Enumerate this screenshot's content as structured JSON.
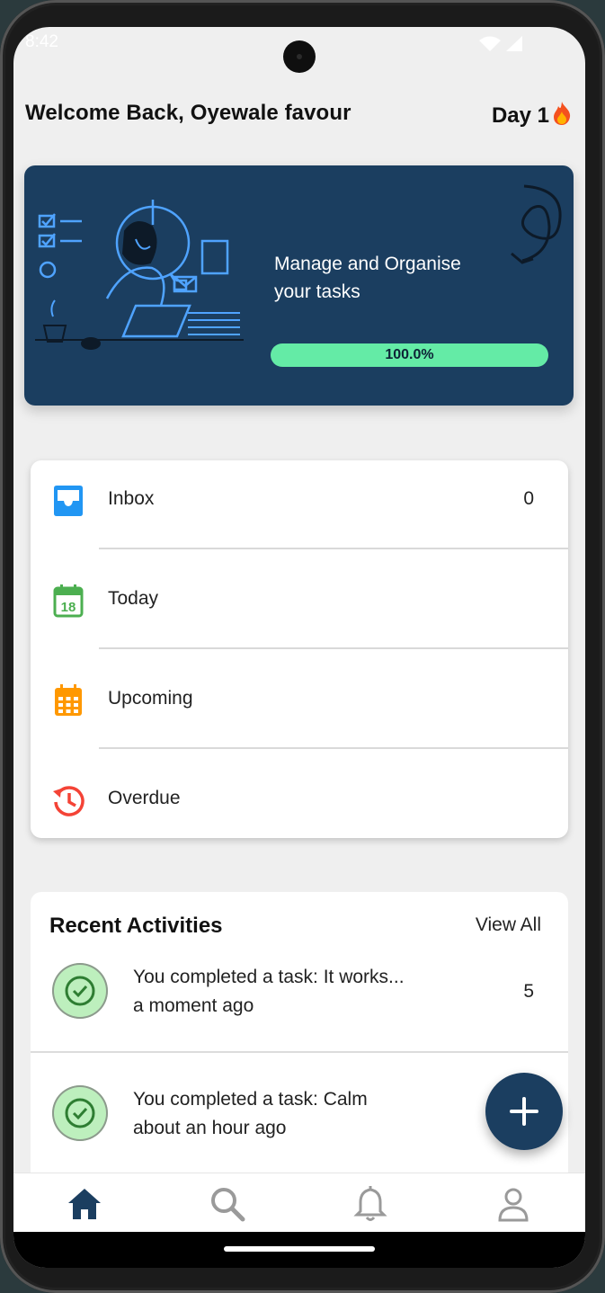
{
  "status_bar": {
    "time": "8:42"
  },
  "header": {
    "welcome": "Welcome Back, Oyewale favour",
    "day": "Day 1",
    "day_icon": "fire-icon"
  },
  "banner": {
    "title": "Manage and Organise your tasks",
    "progress_label": "100.0%",
    "progress_fraction": 1.0,
    "background": "#1b3e60",
    "progress_color": "#64eba6"
  },
  "menu": {
    "items": [
      {
        "label": "Inbox",
        "count": "0",
        "icon": "inbox-icon",
        "color": "#2196f3"
      },
      {
        "label": "Today",
        "count": "",
        "icon": "calendar-today-icon",
        "color": "#4caf50"
      },
      {
        "label": "Upcoming",
        "count": "",
        "icon": "calendar-month-icon",
        "color": "#ff9800"
      },
      {
        "label": "Overdue",
        "count": "",
        "icon": "history-icon",
        "color": "#f44336"
      }
    ]
  },
  "activities": {
    "title": "Recent Activities",
    "view_all": "View All",
    "items": [
      {
        "line1": "You completed a task:  It works...",
        "line2": "a moment ago",
        "count": "5"
      },
      {
        "line1": "You completed a task:  Calm",
        "line2": "about an hour ago",
        "count": ""
      }
    ]
  },
  "fab": {
    "icon": "plus-icon"
  },
  "nav": {
    "items": [
      "home-icon",
      "search-icon",
      "bell-icon",
      "profile-icon"
    ],
    "active": "home-icon",
    "active_color": "#1b3e60",
    "inactive_color": "#9a9a9a"
  }
}
